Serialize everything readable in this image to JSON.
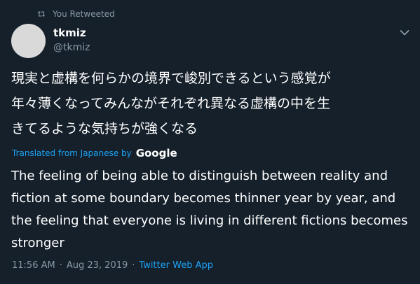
{
  "retweet": {
    "label": "You Retweeted"
  },
  "author": {
    "display_name": "tkmiz",
    "handle": "@tkmiz"
  },
  "tweet": {
    "text": "現実と虚構を何らかの境界で峻別できるという感覚が\n年々薄くなってみんながそれぞれ異なる虚構の中を生\nきてるような気持ちが強くなる",
    "translated_label": "Translated from Japanese by",
    "translator_logo_text": "Google",
    "translated_text": "The feeling of being able to distinguish between reality and fiction at some boundary becomes thinner year by year, and the feeling that everyone is living in different fictions becomes stronger"
  },
  "meta": {
    "time": "11:56 AM",
    "separator": "·",
    "date": "Aug 23, 2019",
    "source": "Twitter Web App"
  },
  "icons": {
    "retweet": "retweet-icon",
    "caret": "chevron-down-icon"
  },
  "colors": {
    "background": "#15202b",
    "secondary_text": "#8899a6",
    "link": "#1da1f2",
    "primary_text": "#ffffff"
  }
}
